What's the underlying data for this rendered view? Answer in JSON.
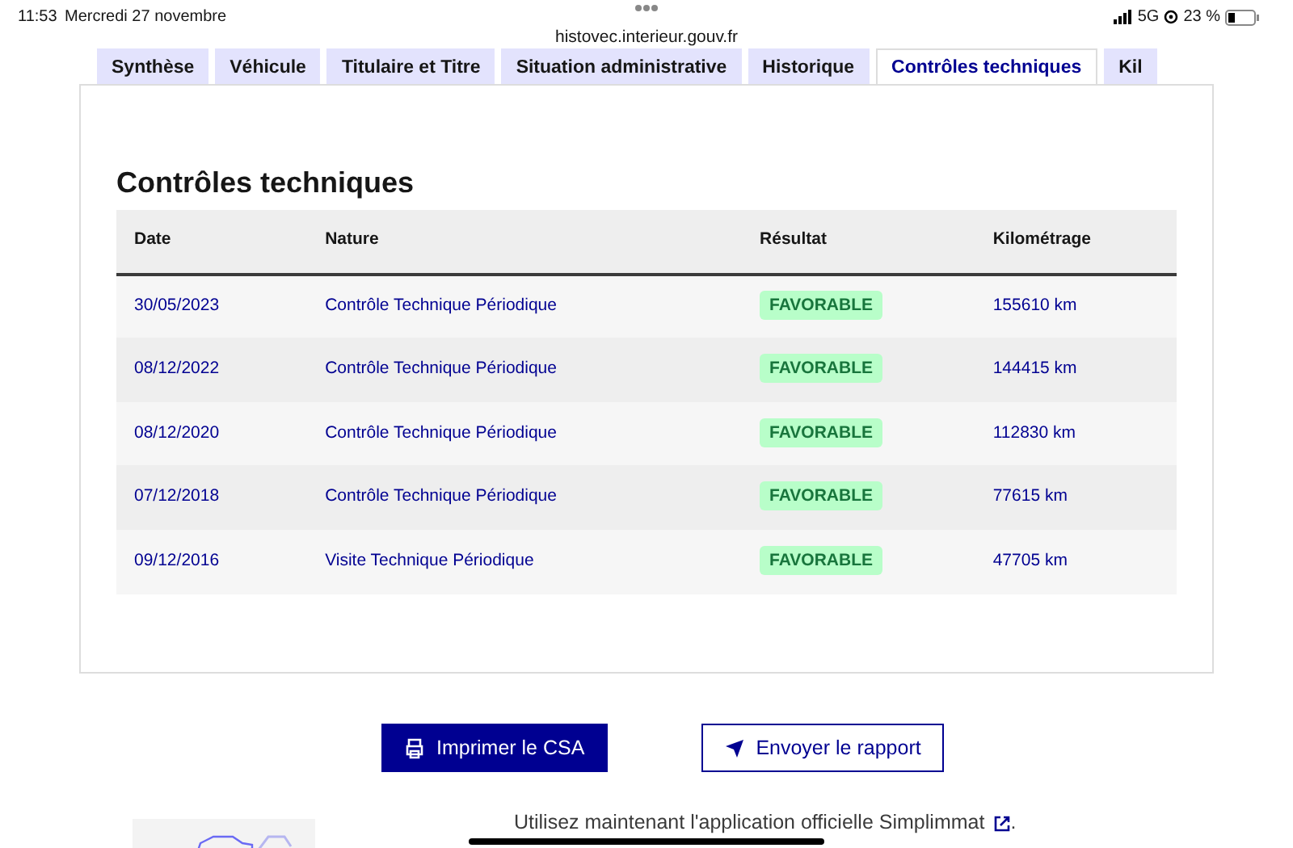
{
  "status_bar": {
    "time": "11:53",
    "date": "Mercredi 27 novembre",
    "url": "histovec.interieur.gouv.fr",
    "network": "5G",
    "battery": "23 %"
  },
  "tabs": [
    {
      "label": "Synthèse",
      "selected": false
    },
    {
      "label": "Véhicule",
      "selected": false
    },
    {
      "label": "Titulaire et Titre",
      "selected": false
    },
    {
      "label": "Situation administrative",
      "selected": false
    },
    {
      "label": "Historique",
      "selected": false
    },
    {
      "label": "Contrôles techniques",
      "selected": true
    },
    {
      "label": "Kil",
      "selected": false
    }
  ],
  "section_title": "Contrôles techniques",
  "table": {
    "columns": [
      "Date",
      "Nature",
      "Résultat",
      "Kilométrage"
    ],
    "rows": [
      {
        "date": "30/05/2023",
        "nature": "Contrôle Technique Périodique",
        "result": "FAVORABLE",
        "mileage": "155610 km"
      },
      {
        "date": "08/12/2022",
        "nature": "Contrôle Technique Périodique",
        "result": "FAVORABLE",
        "mileage": "144415 km"
      },
      {
        "date": "08/12/2020",
        "nature": "Contrôle Technique Périodique",
        "result": "FAVORABLE",
        "mileage": "112830 km"
      },
      {
        "date": "07/12/2018",
        "nature": "Contrôle Technique Périodique",
        "result": "FAVORABLE",
        "mileage": "77615 km"
      },
      {
        "date": "09/12/2016",
        "nature": "Visite Technique Périodique",
        "result": "FAVORABLE",
        "mileage": "47705 km"
      }
    ]
  },
  "buttons": [
    {
      "label": "Imprimer le CSA",
      "kind": "primary"
    },
    {
      "label": "Envoyer le rapport",
      "kind": "secondary"
    }
  ],
  "footer": {
    "text": "Utilisez maintenant l'application officielle",
    "link": "Simplimmat",
    "end": "."
  }
}
